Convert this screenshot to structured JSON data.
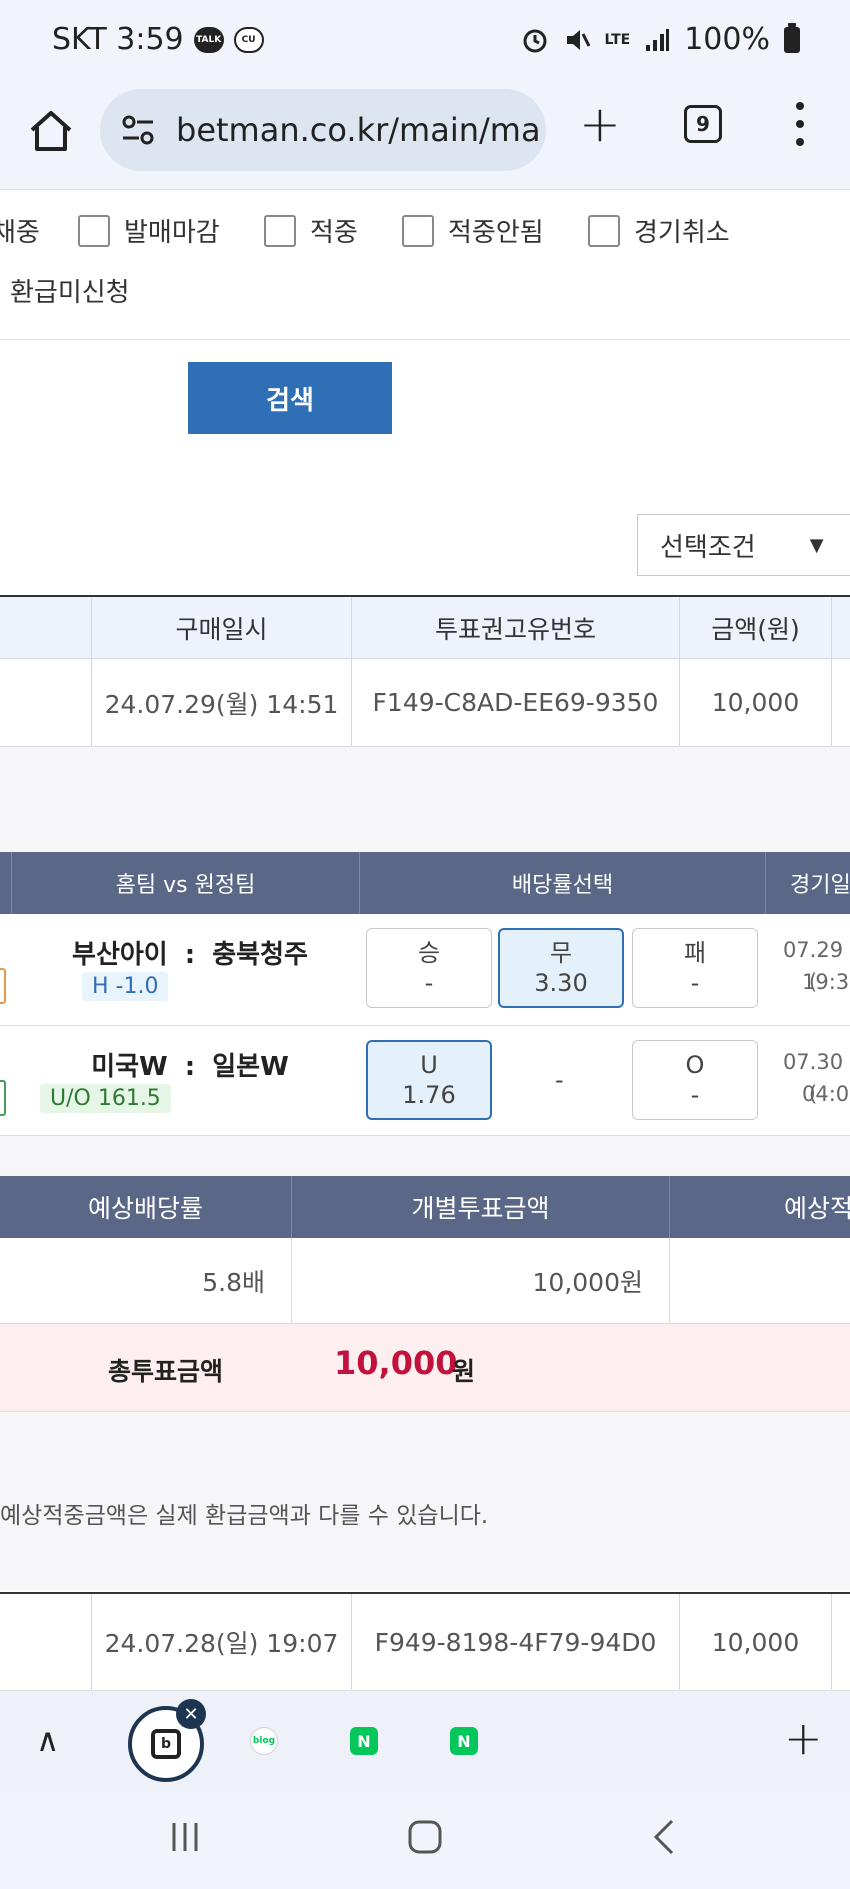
{
  "status": {
    "carrier_time": "SKT 3:59",
    "talk_badge": "TALK",
    "cu_badge": "CU",
    "lte": "LTE",
    "battery": "100%"
  },
  "browser": {
    "url": "betman.co.kr/main/ma",
    "tab_count": "9"
  },
  "filters": {
    "row1": [
      "채중",
      "발매마감",
      "적중",
      "적중안됨",
      "경기취소"
    ],
    "row2": [
      "환급미신청"
    ]
  },
  "search_button": "검색",
  "select": {
    "label": "선택조건",
    "arrow": "▼"
  },
  "table1": {
    "headers": [
      "구매일시",
      "투표권고유번호",
      "금액(원)"
    ],
    "row": [
      "24.07.29(월) 14:51",
      "F149-C8AD-EE69-9350",
      "10,000"
    ]
  },
  "table2": {
    "headers": [
      "홈팀 vs 원정팀",
      "배당률선택",
      "경기일"
    ],
    "games": [
      {
        "home": "부산아이",
        "away": "충북청주",
        "separator": ":",
        "handicap": "H -1.0",
        "odds": [
          {
            "label": "승",
            "value": "-",
            "selected": false
          },
          {
            "label": "무",
            "value": "3.30",
            "selected": true
          },
          {
            "label": "패",
            "value": "-",
            "selected": false
          }
        ],
        "date": "07.29 (",
        "time": "19:3"
      },
      {
        "home": "미국W",
        "away": "일본W",
        "separator": ":",
        "handicap": "U/O 161.5",
        "odds": [
          {
            "label": "U",
            "value": "1.76",
            "selected": true
          },
          {
            "label": "",
            "value": "-",
            "selected": false
          },
          {
            "label": "O",
            "value": "-",
            "selected": false
          }
        ],
        "date": "07.30 (",
        "time": "04:0"
      }
    ]
  },
  "summary": {
    "headers": [
      "예상배당률",
      "개별투표금액",
      "예상적"
    ],
    "values": [
      "5.8배",
      "10,000원",
      ""
    ],
    "total_label": "총투표금액",
    "total_value": "10,000",
    "total_unit": "원"
  },
  "note": "예상적중금액은 실제 환급금액과 다를 수 있습니다.",
  "table4": {
    "row": [
      "24.07.28(일) 19:07",
      "F949-8198-4F79-94D0",
      "10,000"
    ]
  },
  "toolbar": {
    "up": "∧",
    "active_glyph": "b",
    "close": "✕",
    "blog": "blog",
    "naver1": "N",
    "naver2": "N",
    "plus": "+"
  },
  "colors": {
    "accent_blue": "#2f6fb5",
    "header_navy": "#5a6786",
    "total_red": "#c0123c",
    "naver_green": "#03c75a"
  }
}
